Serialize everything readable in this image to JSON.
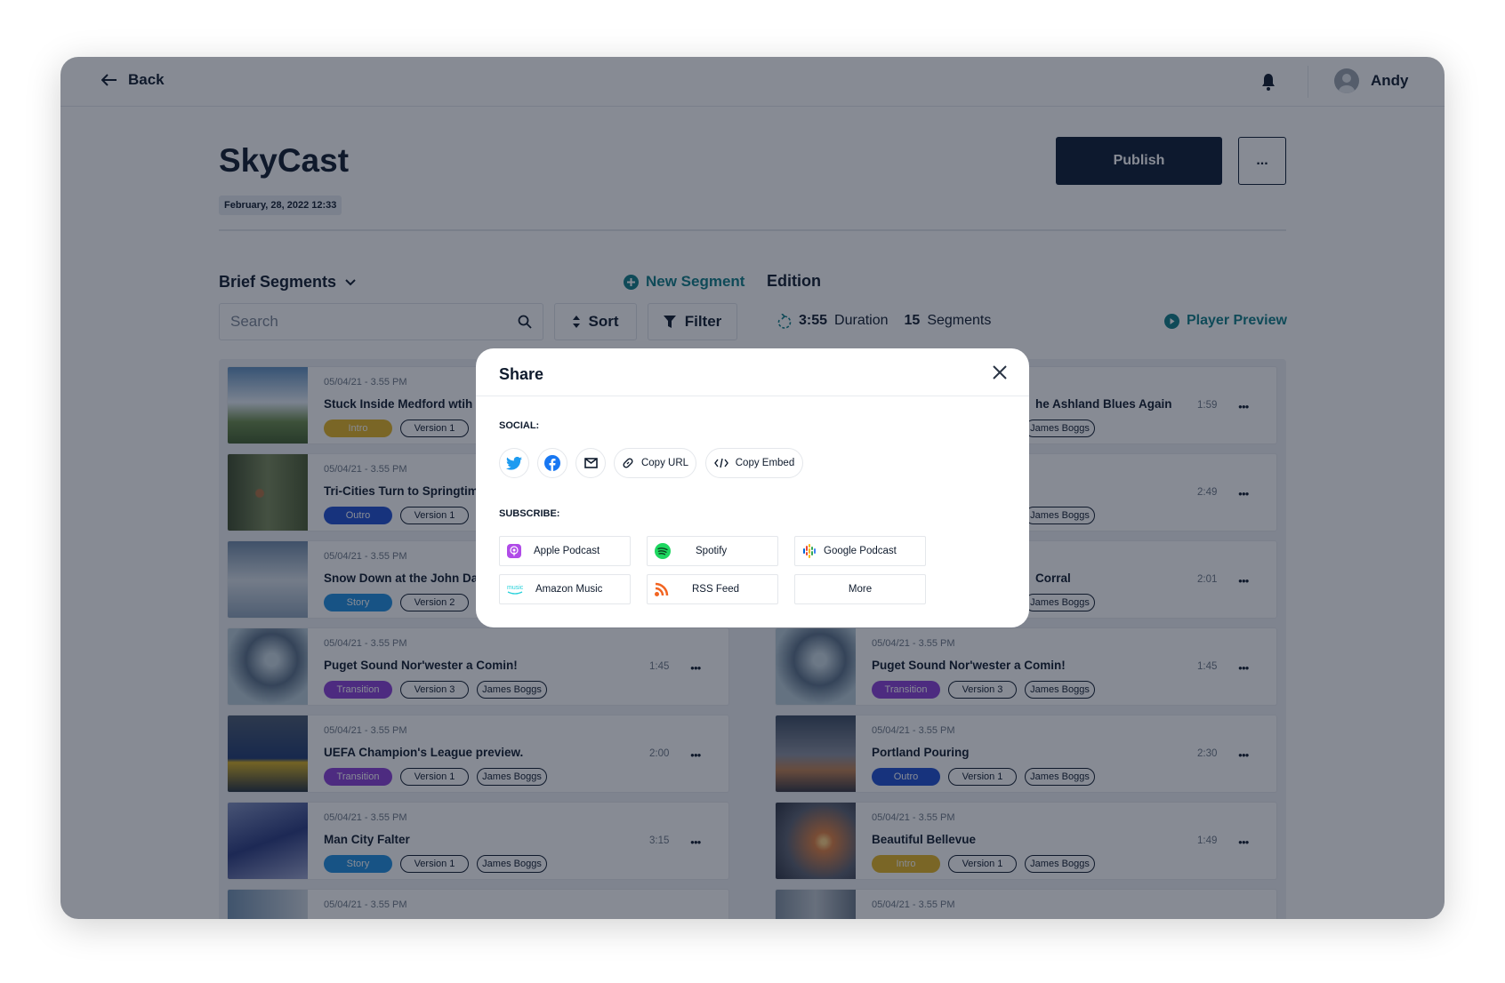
{
  "header": {
    "back_label": "Back",
    "user_name": "Andy"
  },
  "page": {
    "title": "SkyCast",
    "date": "February, 28, 2022 12:33",
    "publish_label": "Publish",
    "more_label": "..."
  },
  "toolbar": {
    "segments_dropdown": "Brief Segments",
    "new_segment": "New Segment",
    "edition": "Edition",
    "search_placeholder": "Search",
    "sort": "Sort",
    "filter": "Filter",
    "duration_value": "3:55",
    "duration_label": "Duration",
    "segments_count": "15",
    "segments_label": "Segments",
    "player_preview": "Player Preview"
  },
  "tag_colors": {
    "Intro": "#e4b422",
    "Outro": "#1f4fd1",
    "Story": "#1e8fe0",
    "Transition": "#8a3fd6"
  },
  "left_cards": [
    {
      "date": "05/04/21 - 3.55 PM",
      "title": "Stuck Inside Medford wtih t",
      "type": "Intro",
      "version": "Version 1",
      "author": "",
      "duration": ""
    },
    {
      "date": "05/04/21 - 3.55 PM",
      "title": "Tri-Cities Turn to Springtime",
      "type": "Outro",
      "version": "Version 1",
      "author": "",
      "duration": ""
    },
    {
      "date": "05/04/21 - 3.55 PM",
      "title": "Snow Down at the John Day",
      "type": "Story",
      "version": "Version 2",
      "author": "",
      "duration": ""
    },
    {
      "date": "05/04/21 - 3.55 PM",
      "title": "Puget Sound Nor'wester a Comin!",
      "type": "Transition",
      "version": "Version 3",
      "author": "James Boggs",
      "duration": "1:45"
    },
    {
      "date": "05/04/21 - 3.55 PM",
      "title": "UEFA Champion's League preview.",
      "type": "Transition",
      "version": "Version 1",
      "author": "James Boggs",
      "duration": "2:00"
    },
    {
      "date": "05/04/21 - 3.55 PM",
      "title": "Man City Falter",
      "type": "Story",
      "version": "Version 1",
      "author": "James Boggs",
      "duration": "3:15"
    },
    {
      "date": "05/04/21 - 3.55 PM",
      "title": "",
      "type": "",
      "version": "",
      "author": "",
      "duration": ""
    }
  ],
  "right_cards": [
    {
      "date": "",
      "title": "he Ashland Blues Again",
      "type": "",
      "version": "",
      "author": "James Boggs",
      "duration": "1:59"
    },
    {
      "date": "",
      "title": "",
      "type": "",
      "version": "",
      "author": "James Boggs",
      "duration": "2:49"
    },
    {
      "date": "",
      "title": "Corral",
      "type": "",
      "version": "",
      "author": "James Boggs",
      "duration": "2:01"
    },
    {
      "date": "05/04/21 - 3.55 PM",
      "title": "Puget Sound Nor'wester a Comin!",
      "type": "Transition",
      "version": "Version 3",
      "author": "James Boggs",
      "duration": "1:45"
    },
    {
      "date": "05/04/21 - 3.55 PM",
      "title": "Portland Pouring",
      "type": "Outro",
      "version": "Version 1",
      "author": "James Boggs",
      "duration": "2:30"
    },
    {
      "date": "05/04/21 - 3.55 PM",
      "title": "Beautiful Bellevue",
      "type": "Intro",
      "version": "Version 1",
      "author": "James Boggs",
      "duration": "1:49"
    },
    {
      "date": "05/04/21 - 3.55 PM",
      "title": "",
      "type": "",
      "version": "",
      "author": "",
      "duration": ""
    }
  ],
  "modal": {
    "title": "Share",
    "social_label": "SOCIAL:",
    "copy_url": "Copy URL",
    "copy_embed": "Copy Embed",
    "subscribe_label": "SUBSCRIBE:",
    "subscribe": [
      "Apple Podcast",
      "Spotify",
      "Google Podcast",
      "Amazon Music",
      "RSS Feed",
      "More"
    ],
    "social_icons": [
      "twitter-icon",
      "facebook-icon",
      "mail-icon"
    ]
  }
}
